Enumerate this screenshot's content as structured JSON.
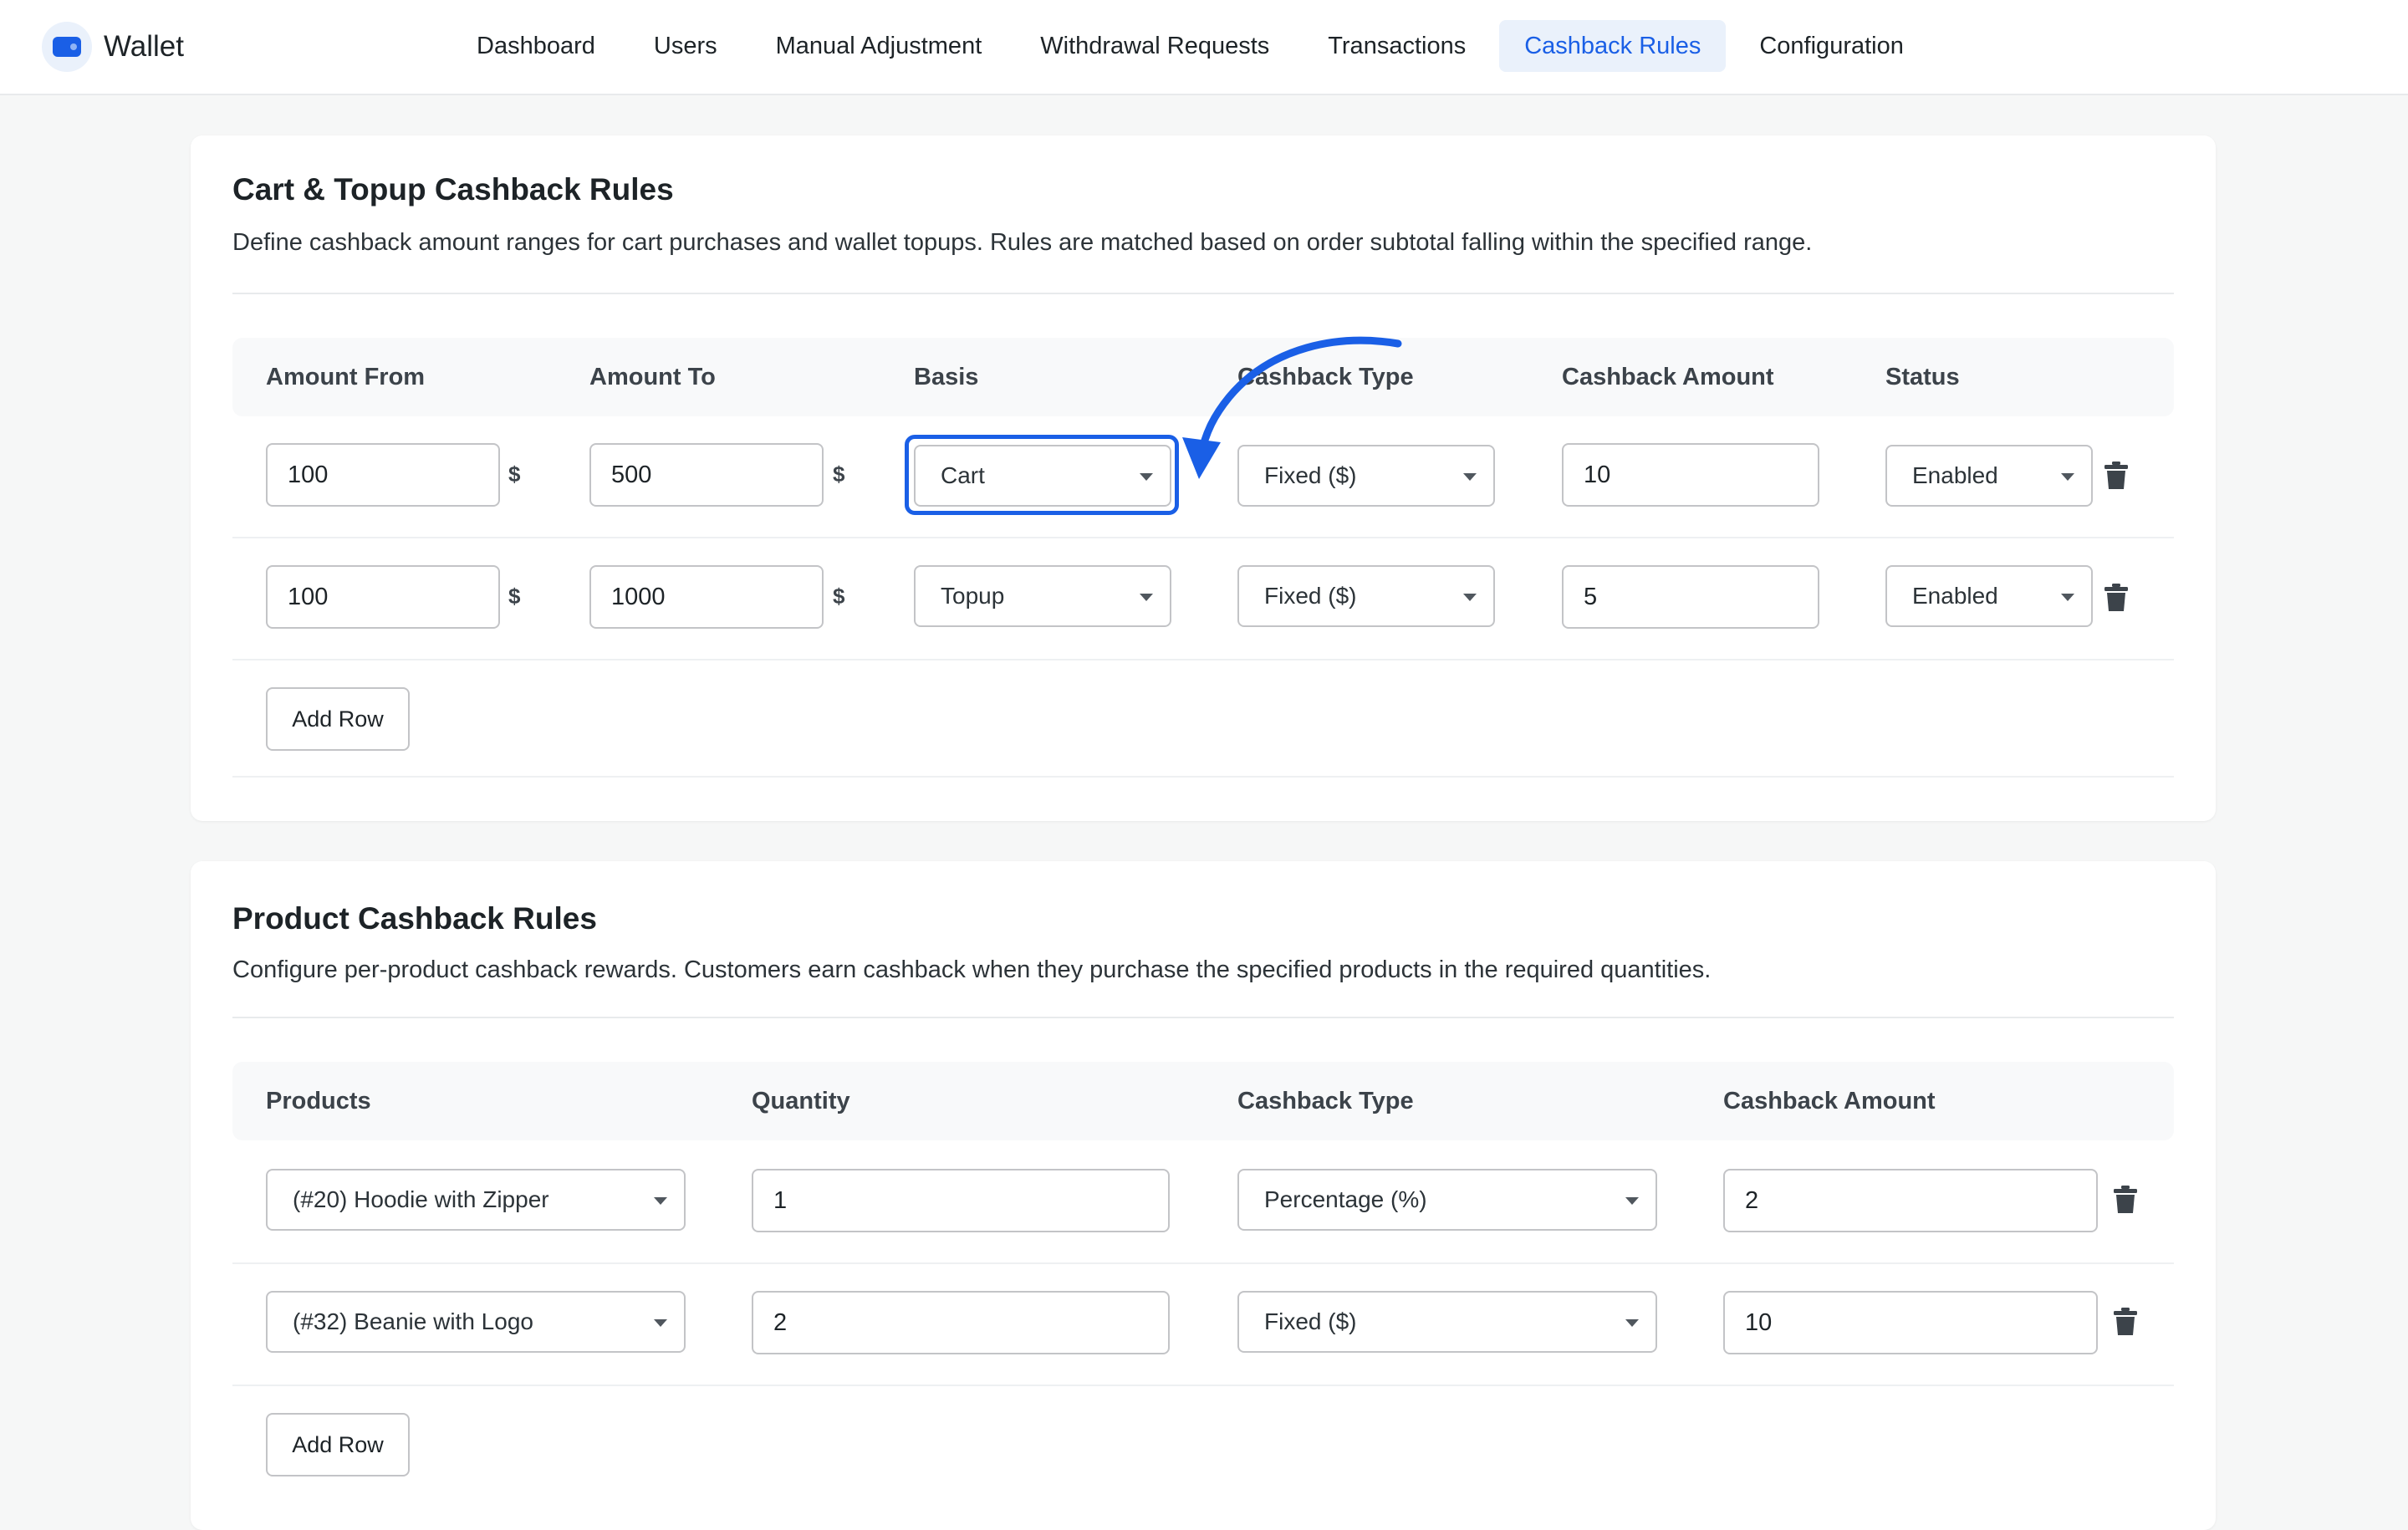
{
  "app": {
    "name": "Wallet"
  },
  "colors": {
    "accent": "#1a5fe6",
    "background": "#f6f7f7",
    "card": "#ffffff",
    "border": "#c3c4c7"
  },
  "nav": {
    "items": [
      {
        "label": "Dashboard"
      },
      {
        "label": "Users"
      },
      {
        "label": "Manual Adjustment"
      },
      {
        "label": "Withdrawal Requests"
      },
      {
        "label": "Transactions"
      },
      {
        "label": "Cashback Rules",
        "active": true
      },
      {
        "label": "Configuration"
      }
    ]
  },
  "cart_rules": {
    "title": "Cart & Topup Cashback Rules",
    "description": "Define cashback amount ranges for cart purchases and wallet topups. Rules are matched based on order subtotal falling within the specified range.",
    "headers": {
      "amount_from": "Amount From",
      "amount_to": "Amount To",
      "basis": "Basis",
      "cashback_type": "Cashback Type",
      "cashback_amount": "Cashback Amount",
      "status": "Status"
    },
    "currency_unit": "$",
    "rows": [
      {
        "amount_from": "100",
        "amount_to": "500",
        "basis": "Cart",
        "cashback_type": "Fixed ($)",
        "cashback_amount": "10",
        "status": "Enabled"
      },
      {
        "amount_from": "100",
        "amount_to": "1000",
        "basis": "Topup",
        "cashback_type": "Fixed ($)",
        "cashback_amount": "5",
        "status": "Enabled"
      }
    ],
    "add_row_label": "Add Row"
  },
  "product_rules": {
    "title": "Product Cashback Rules",
    "description": "Configure per-product cashback rewards. Customers earn cashback when they purchase the specified products in the required quantities.",
    "headers": {
      "products": "Products",
      "quantity": "Quantity",
      "cashback_type": "Cashback Type",
      "cashback_amount": "Cashback Amount"
    },
    "rows": [
      {
        "product": "(#20) Hoodie with Zipper",
        "quantity": "1",
        "cashback_type": "Percentage (%)",
        "cashback_amount": "2"
      },
      {
        "product": "(#32) Beanie with Logo",
        "quantity": "2",
        "cashback_type": "Fixed ($)",
        "cashback_amount": "10"
      }
    ],
    "add_row_label": "Add Row"
  }
}
